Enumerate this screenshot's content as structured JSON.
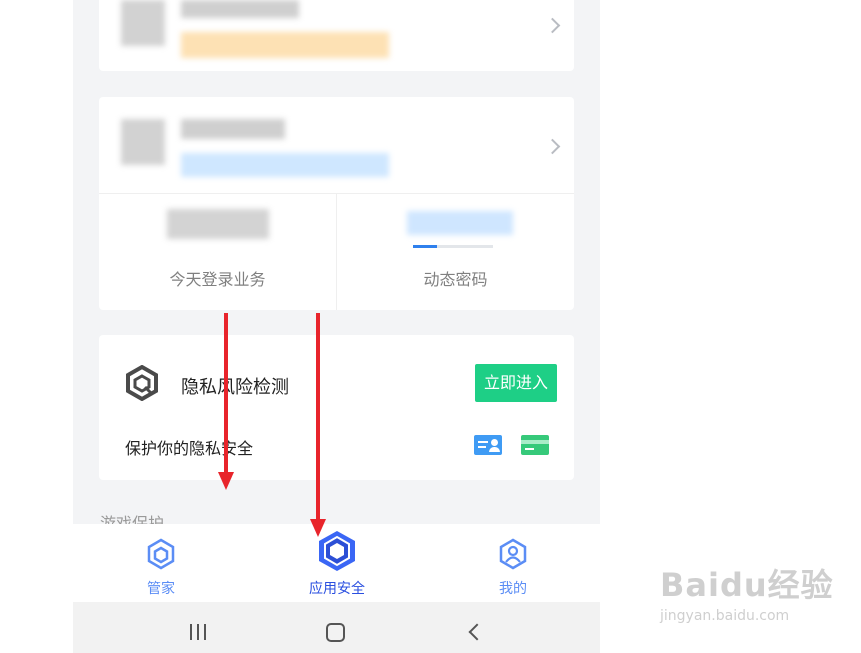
{
  "stats": {
    "left_label": "今天登录业务",
    "right_label": "动态密码"
  },
  "privacy": {
    "title": "隐私风险检测",
    "subtitle": "保护你的隐私安全",
    "enter_button": "立即进入"
  },
  "section_partial_title": "游戏保护",
  "tabs": [
    {
      "label": "管家",
      "icon": "hexagon-icon",
      "active": false
    },
    {
      "label": "应用安全",
      "icon": "shield-box-icon",
      "active": true
    },
    {
      "label": "我的",
      "icon": "user-hexagon-icon",
      "active": false
    }
  ],
  "system_nav": {
    "recent": "recent-apps-icon",
    "home": "home-icon",
    "back": "back-icon"
  },
  "colors": {
    "accent_blue": "#3a66f5",
    "enter_green": "#1ecf86",
    "arrow_red": "#e8242b"
  },
  "watermark": {
    "brand": "Baidu经验",
    "url": "jingyan.baidu.com"
  }
}
